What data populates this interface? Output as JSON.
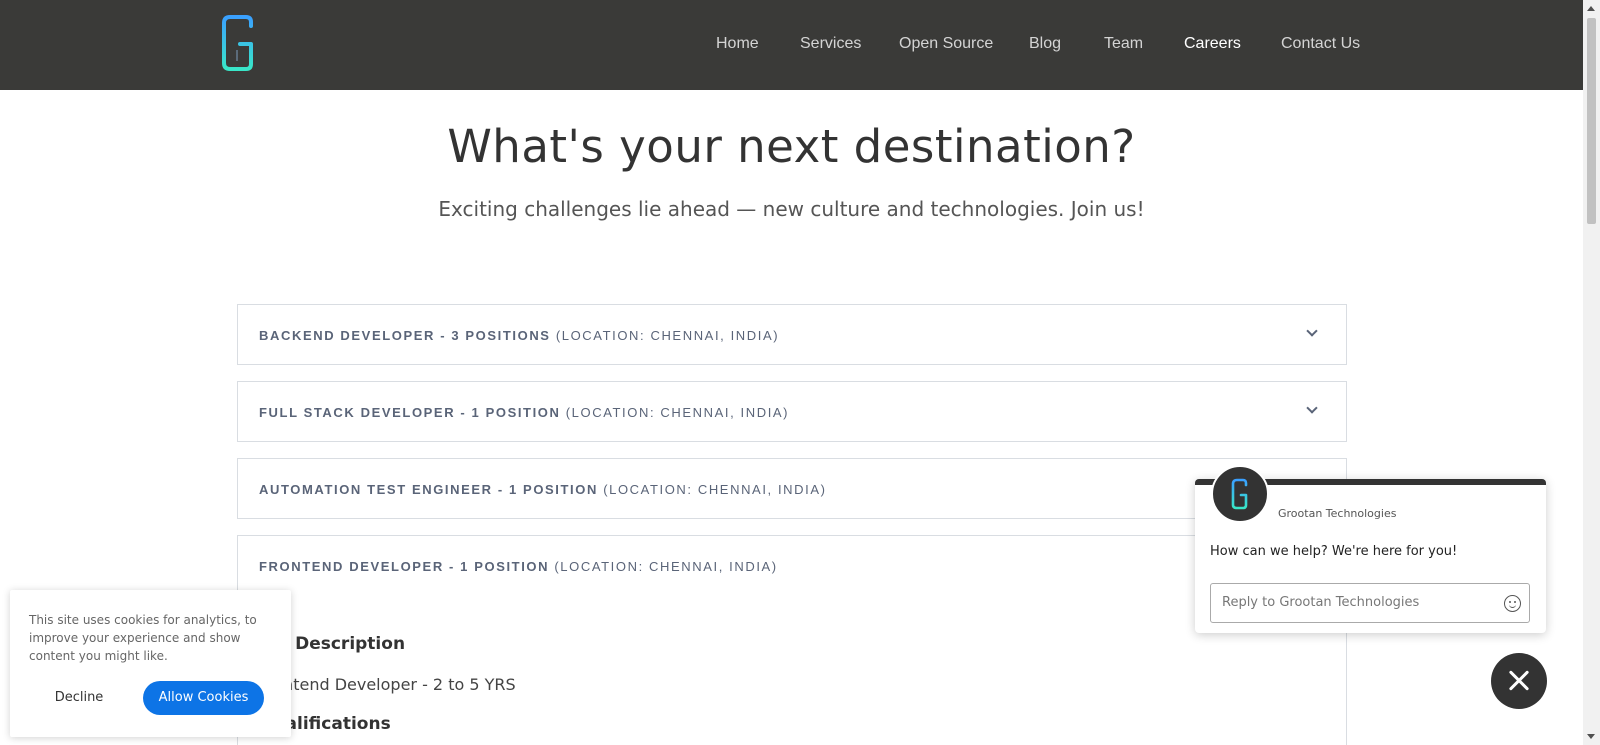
{
  "colors": {
    "header_bg": "#3a3a38",
    "accent_blue": "#0d74e6",
    "logo_gradient_start": "#3aa0ff",
    "logo_gradient_end": "#39e6c8"
  },
  "header": {
    "logo_icon": "grootan-g-logo-icon",
    "nav": [
      {
        "label": "Home",
        "active": false
      },
      {
        "label": "Services",
        "active": false
      },
      {
        "label": "Open Source",
        "active": false
      },
      {
        "label": "Blog",
        "active": false
      },
      {
        "label": "Team",
        "active": false
      },
      {
        "label": "Careers",
        "active": true
      },
      {
        "label": "Contact Us",
        "active": false
      }
    ]
  },
  "hero": {
    "title": "What's your next destination?",
    "subtitle": "Exciting challenges lie ahead — new culture and technologies. Join us!"
  },
  "jobs": [
    {
      "title": "BACKEND DEVELOPER - 3 POSITIONS",
      "location": "(LOCATION: CHENNAI, INDIA)",
      "expanded": false
    },
    {
      "title": "FULL STACK DEVELOPER - 1 POSITION",
      "location": "(LOCATION: CHENNAI, INDIA)",
      "expanded": false
    },
    {
      "title": "AUTOMATION TEST ENGINEER - 1 POSITION",
      "location": "(LOCATION: CHENNAI, INDIA)",
      "expanded": false
    },
    {
      "title": "FRONTEND DEVELOPER - 1 POSITION",
      "location": "(LOCATION: CHENNAI, INDIA)",
      "expanded": true,
      "details": {
        "heading1": "Job Description",
        "line1": "Frontend Developer - 2 to 5 YRS",
        "heading2": "Qualifications"
      }
    }
  ],
  "cookie": {
    "text": "This site uses cookies for analytics, to improve your experience and show content you might like.",
    "decline_label": "Decline",
    "allow_label": "Allow Cookies"
  },
  "chat": {
    "company": "Grootan Technologies",
    "message": "How can we help? We're here for you!",
    "placeholder": "Reply to Grootan Technologies",
    "emoji_icon": "smiley-emoji-icon",
    "close_icon": "close-icon"
  }
}
